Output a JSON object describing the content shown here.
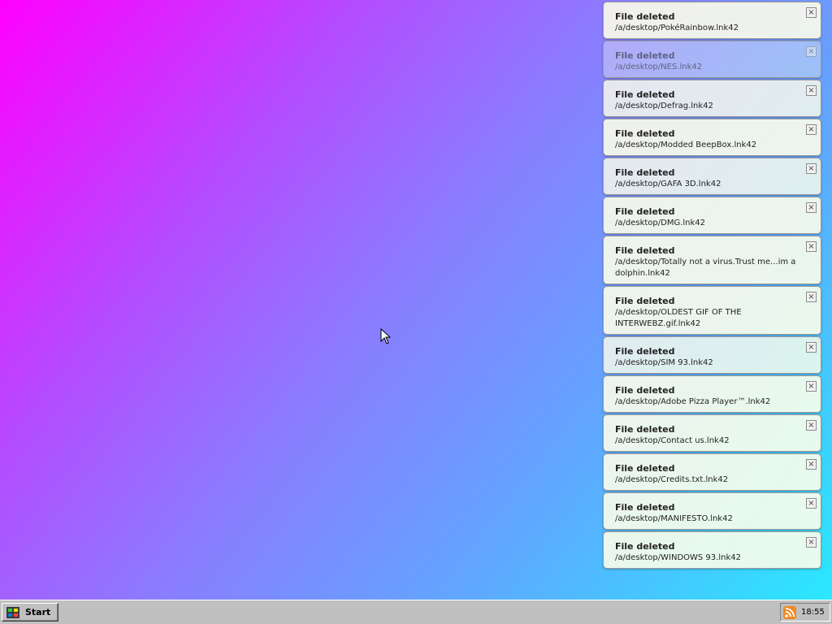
{
  "notifications": [
    {
      "title": "File deleted",
      "path": "/a/desktop/PokéRainbow.lnk42",
      "close": "×"
    },
    {
      "title": "File deleted",
      "path": "/a/desktop/NES.lnk42",
      "close": "×"
    },
    {
      "title": "File deleted",
      "path": "/a/desktop/Defrag.lnk42",
      "close": "×"
    },
    {
      "title": "File deleted",
      "path": "/a/desktop/Modded BeepBox.lnk42",
      "close": "×"
    },
    {
      "title": "File deleted",
      "path": "/a/desktop/GAFA 3D.lnk42",
      "close": "×"
    },
    {
      "title": "File deleted",
      "path": "/a/desktop/DMG.lnk42",
      "close": "×"
    },
    {
      "title": "File deleted",
      "path": "/a/desktop/Totally not a virus.Trust me...im a dolphin.lnk42",
      "close": "×"
    },
    {
      "title": "File deleted",
      "path": "/a/desktop/OLDEST GIF OF THE INTERWEBZ.gif.lnk42",
      "close": "×"
    },
    {
      "title": "File deleted",
      "path": "/a/desktop/SIM 93.lnk42",
      "close": "×"
    },
    {
      "title": "File deleted",
      "path": "/a/desktop/Adobe Pizza Player™.lnk42",
      "close": "×"
    },
    {
      "title": "File deleted",
      "path": "/a/desktop/Contact us.lnk42",
      "close": "×"
    },
    {
      "title": "File deleted",
      "path": "/a/desktop/Credits.txt.lnk42",
      "close": "×"
    },
    {
      "title": "File deleted",
      "path": "/a/desktop/MANIFESTO.lnk42",
      "close": "×"
    },
    {
      "title": "File deleted",
      "path": "/a/desktop/WINDOWS 93.lnk42",
      "close": "×"
    }
  ],
  "taskbar": {
    "start_label": "Start",
    "clock": "18:55",
    "tray_icon": "rss-icon"
  },
  "colors": {
    "desktop_gradient_start": "#ff00ff",
    "desktop_gradient_end": "#2ae8ff",
    "taskbar": "#c0c0c0",
    "notification_bg": "#ffffeb",
    "rss_accent": "#f08a24"
  }
}
